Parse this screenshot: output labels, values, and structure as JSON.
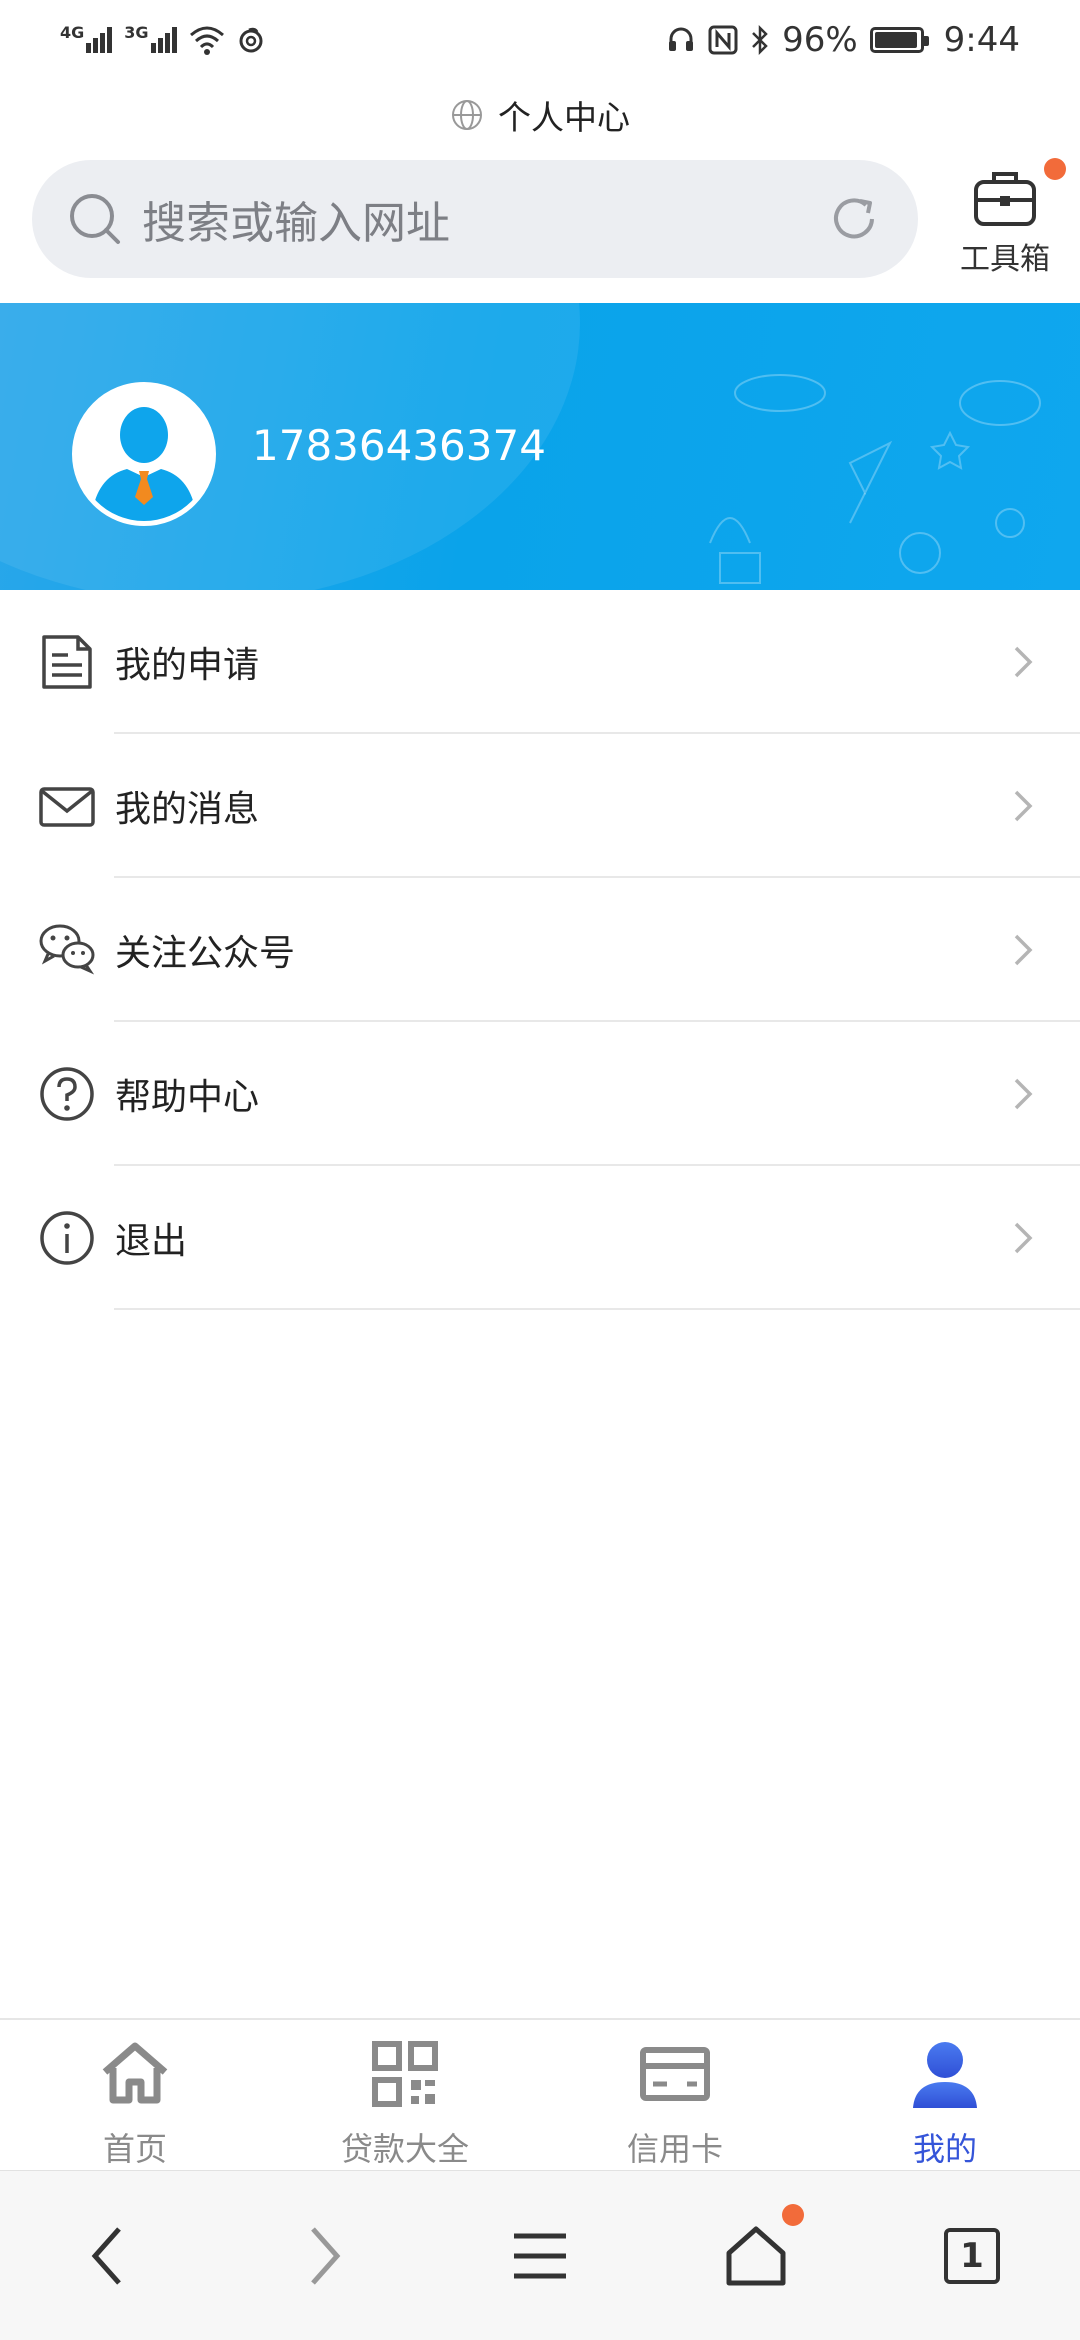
{
  "status_bar": {
    "signal_1": "4G",
    "signal_2": "3G",
    "battery_percent_label": "96%",
    "battery_level": 0.96,
    "time": "9:44"
  },
  "page_title": "个人中心",
  "search": {
    "placeholder": "搜索或输入网址"
  },
  "toolbox": {
    "label": "工具箱"
  },
  "profile": {
    "phone": "17836436374"
  },
  "menu": {
    "items": [
      {
        "label": "我的申请",
        "icon": "document-icon"
      },
      {
        "label": "我的消息",
        "icon": "envelope-icon"
      },
      {
        "label": "关注公众号",
        "icon": "wechat-icon"
      },
      {
        "label": "帮助中心",
        "icon": "question-icon"
      },
      {
        "label": "退出",
        "icon": "info-icon"
      }
    ]
  },
  "tabbar": {
    "tabs": [
      {
        "label": "首页",
        "icon": "home-icon"
      },
      {
        "label": "贷款大全",
        "icon": "grid-icon"
      },
      {
        "label": "信用卡",
        "icon": "credit-card-icon"
      },
      {
        "label": "我的",
        "icon": "person-icon",
        "active": true
      }
    ]
  },
  "browser_nav": {
    "tab_count": "1"
  },
  "colors": {
    "banner": "#0aa3ea",
    "active_tab": "#3555d9",
    "badge": "#f26b3a"
  }
}
